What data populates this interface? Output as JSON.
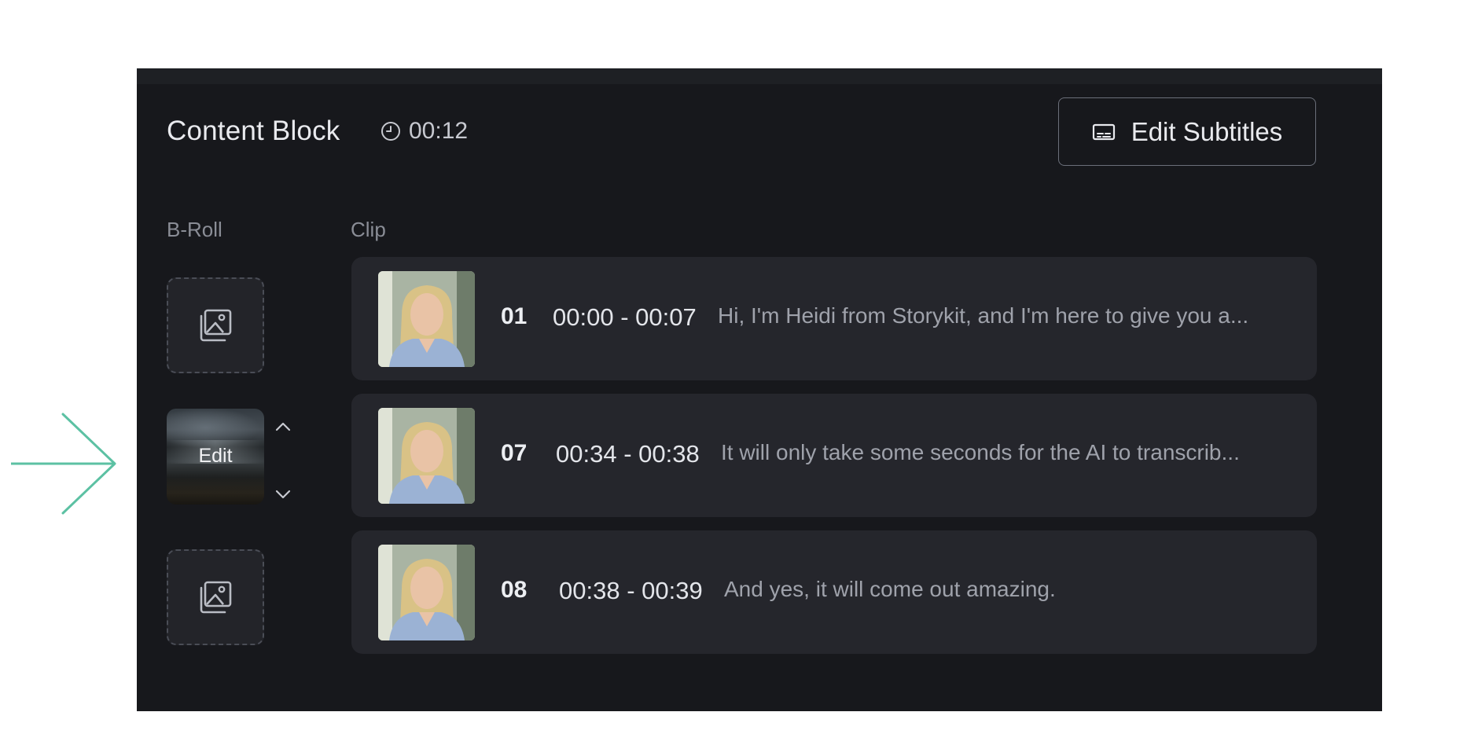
{
  "content_block": {
    "title": "Content Block",
    "duration": "00:12",
    "duration_icon": "clock-icon",
    "edit_subtitles_label": "Edit Subtitles",
    "edit_subtitles_icon": "subtitles-icon"
  },
  "columns": {
    "broll": "B-Roll",
    "clip": "Clip"
  },
  "broll": {
    "edit_label": "Edit",
    "empty_icon": "add-image-icon",
    "up_icon": "chevron-up-icon",
    "down_icon": "chevron-down-icon"
  },
  "clips": [
    {
      "number": "01",
      "time": "00:00 - 00:07",
      "text": "Hi, I'm Heidi from Storykit, and I'm here to give you a..."
    },
    {
      "number": "07",
      "time": "00:34 - 00:38",
      "text": "It will only take some seconds for the AI to transcrib..."
    },
    {
      "number": "08",
      "time": "00:38 - 00:39",
      "text": "And yes, it will come out amazing."
    }
  ],
  "colors": {
    "annotation_arrow": "#5cc1a3",
    "panel_bg": "#17181c",
    "row_bg": "#25262c"
  }
}
